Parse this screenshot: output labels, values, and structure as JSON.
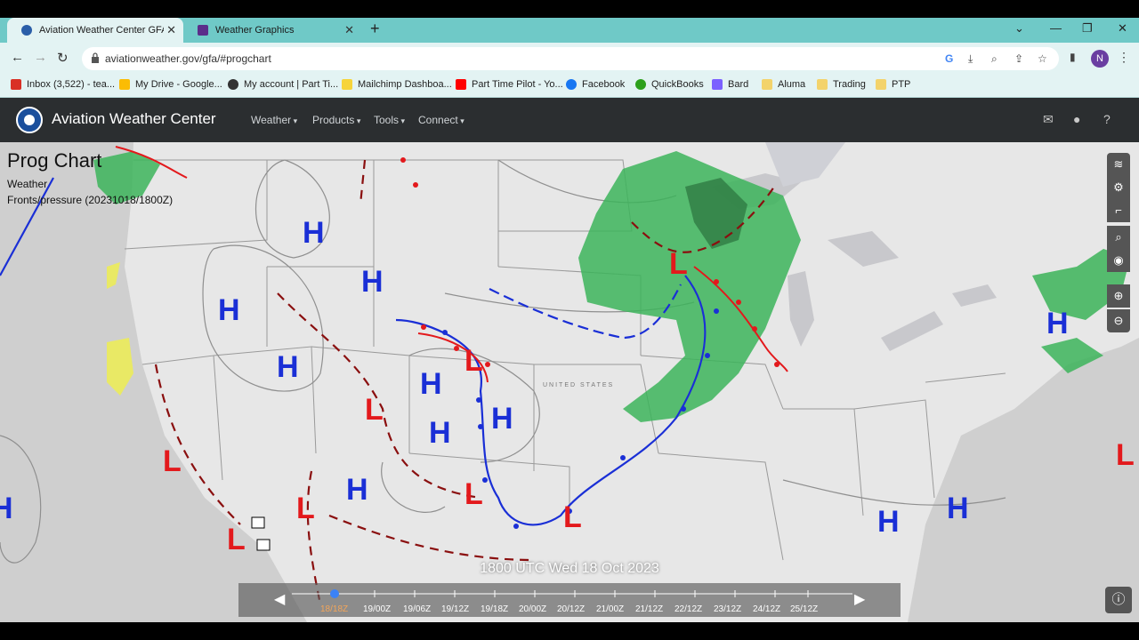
{
  "browser": {
    "tabs": [
      {
        "label": "Aviation Weather Center GFA: Prog"
      },
      {
        "label": "Weather Graphics"
      }
    ],
    "url": "aviationweather.gov/gfa/#progchart",
    "profile_initial": "N",
    "bookmarks": [
      "Inbox (3,522) - tea...",
      "My Drive - Google...",
      "My account | Part Ti...",
      "Mailchimp Dashboa...",
      "Part Time Pilot - Yo...",
      "Facebook",
      "QuickBooks",
      "Bard",
      "Aluma",
      "Trading",
      "PTP"
    ]
  },
  "site": {
    "name": "Aviation Weather Center",
    "menu": [
      "Weather",
      "Products",
      "Tools",
      "Connect"
    ]
  },
  "map": {
    "title": "Prog Chart",
    "layer1": "Weather",
    "layer2": "Fronts/pressure (20231018/1800Z)",
    "country_label": "UNITED STATES",
    "pressure_centers": [
      {
        "type": "H"
      },
      {
        "type": "H"
      },
      {
        "type": "H"
      },
      {
        "type": "H"
      },
      {
        "type": "H"
      },
      {
        "type": "H"
      },
      {
        "type": "H"
      },
      {
        "type": "H"
      },
      {
        "type": "H"
      },
      {
        "type": "H"
      },
      {
        "type": "H"
      },
      {
        "type": "H"
      },
      {
        "type": "L"
      },
      {
        "type": "L"
      },
      {
        "type": "L"
      },
      {
        "type": "L"
      },
      {
        "type": "L"
      },
      {
        "type": "L"
      },
      {
        "type": "L"
      },
      {
        "type": "L"
      },
      {
        "type": "L"
      }
    ],
    "timeline": {
      "current": "1800 UTC Wed 18 Oct 2023",
      "ticks": [
        "18/18Z",
        "19/00Z",
        "19/06Z",
        "19/12Z",
        "19/18Z",
        "20/00Z",
        "20/12Z",
        "21/00Z",
        "21/12Z",
        "22/12Z",
        "23/12Z",
        "24/12Z",
        "25/12Z"
      ]
    }
  },
  "colors": {
    "high": "#1a2fd6",
    "low": "#e3191c",
    "precip": "#3cb45a",
    "accent_tab": "#6fc9c7"
  }
}
